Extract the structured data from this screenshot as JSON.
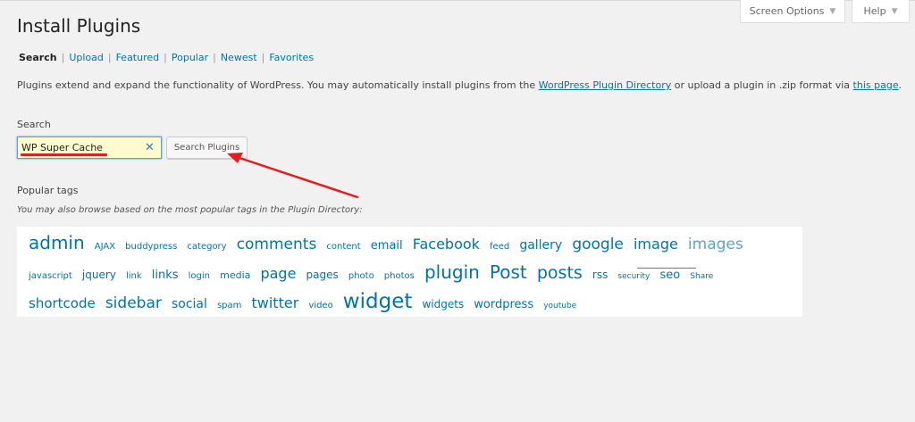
{
  "header": {
    "title": "Install Plugins",
    "screen_options_label": "Screen Options",
    "help_label": "Help"
  },
  "subnav": [
    {
      "label": "Search",
      "current": true
    },
    {
      "label": "Upload"
    },
    {
      "label": "Featured"
    },
    {
      "label": "Popular"
    },
    {
      "label": "Newest"
    },
    {
      "label": "Favorites"
    }
  ],
  "intro": {
    "text_before": "Plugins extend and expand the functionality of WordPress. You may automatically install plugins from the ",
    "link_directory": "WordPress Plugin Directory",
    "text_middle": " or upload a plugin in .zip format via ",
    "link_page": "this page",
    "text_after": "."
  },
  "search": {
    "label": "Search",
    "value": "WP Super Cache",
    "button_label": "Search Plugins",
    "clear_glyph": "✕"
  },
  "popular": {
    "heading": "Popular tags",
    "description": "You may also browse based on the most popular tags in the Plugin Directory:"
  },
  "tags": [
    {
      "label": "admin",
      "size": 20
    },
    {
      "label": "AJAX",
      "size": 10
    },
    {
      "label": "buddypress",
      "size": 10
    },
    {
      "label": "category",
      "size": 10
    },
    {
      "label": "comments",
      "size": 17
    },
    {
      "label": "content",
      "size": 10
    },
    {
      "label": "email",
      "size": 13
    },
    {
      "label": "Facebook",
      "size": 16
    },
    {
      "label": "feed",
      "size": 10
    },
    {
      "label": "gallery",
      "size": 14
    },
    {
      "label": "google",
      "size": 17
    },
    {
      "label": "image",
      "size": 16
    },
    {
      "label": "images",
      "size": 17,
      "light": true
    },
    {
      "label": "javascript",
      "size": 10
    },
    {
      "label": "jquery",
      "size": 12
    },
    {
      "label": "link",
      "size": 10
    },
    {
      "label": "links",
      "size": 13
    },
    {
      "label": "login",
      "size": 10
    },
    {
      "label": "media",
      "size": 11
    },
    {
      "label": "page",
      "size": 16
    },
    {
      "label": "pages",
      "size": 12
    },
    {
      "label": "photo",
      "size": 10
    },
    {
      "label": "photos",
      "size": 10
    },
    {
      "label": "plugin",
      "size": 20
    },
    {
      "label": "Post",
      "size": 20
    },
    {
      "label": "posts",
      "size": 19
    },
    {
      "label": "rss",
      "size": 12
    },
    {
      "label": "security",
      "size": 9
    },
    {
      "label": "seo",
      "size": 13
    },
    {
      "label": "Share",
      "size": 9
    },
    {
      "label": "shortcode",
      "size": 15
    },
    {
      "label": "sidebar",
      "size": 17
    },
    {
      "label": "social",
      "size": 14
    },
    {
      "label": "spam",
      "size": 10
    },
    {
      "label": "twitter",
      "size": 16
    },
    {
      "label": "video",
      "size": 10
    },
    {
      "label": "widget",
      "size": 23
    },
    {
      "label": "widgets",
      "size": 12
    },
    {
      "label": "wordpress",
      "size": 13
    },
    {
      "label": "youtube",
      "size": 9
    }
  ],
  "colors": {
    "link": "#0073aa",
    "annotation": "#e02020",
    "input_highlight": "#fffbcc"
  }
}
